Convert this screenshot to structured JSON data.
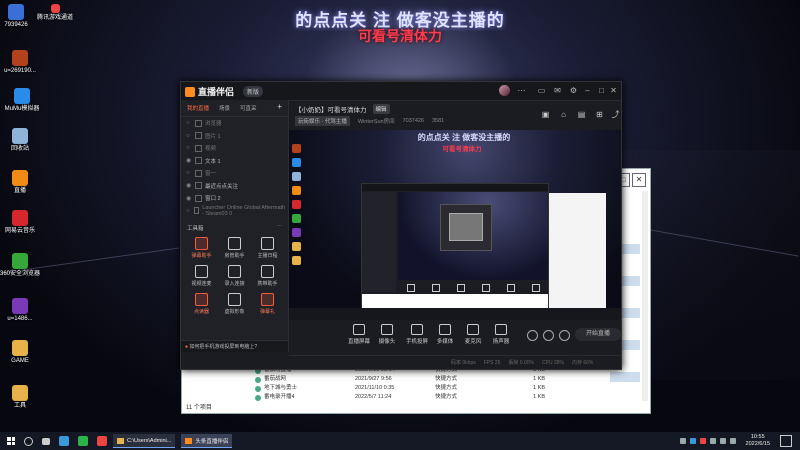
{
  "wallpaper": {
    "banner_title": "的点点关 注 做客没主播的",
    "banner_sub": "可看号清体力"
  },
  "desktop_icons": [
    {
      "label": "7939426",
      "color": "#3a6fd8"
    },
    {
      "label": "u=269190...",
      "color": "#b2421c"
    },
    {
      "label": "MuMu模拟器",
      "color": "#2a8ce8"
    },
    {
      "label": "回收站",
      "color": "#8fb3d9"
    },
    {
      "label": "直播",
      "color": "#f28a16"
    },
    {
      "label": "网易云音乐",
      "color": "#d6262e"
    },
    {
      "label": "360安全浏览器",
      "color": "#36a83a"
    },
    {
      "label": "u=1486...",
      "color": "#7a3ab8"
    },
    {
      "label": "GAME",
      "color": "#e8b24a"
    },
    {
      "label": "工具",
      "color": "#e8b24a"
    }
  ],
  "desktop_top_icon": {
    "label": "腾讯游戏通道",
    "color": "#e44"
  },
  "explorer": {
    "rows": [
      {
        "name": "番茄场直播",
        "date": "2022/2/22 23:14",
        "type": "快捷方式",
        "size": "1 KB"
      },
      {
        "name": "番茄战网",
        "date": "2021/9/27 9:56",
        "type": "快捷方式",
        "size": "1 KB"
      },
      {
        "name": "地下城与勇士",
        "date": "2021/11/10 0:35",
        "type": "快捷方式",
        "size": "1 KB"
      },
      {
        "name": "番电录开播4",
        "date": "2022/5/7 11:24",
        "type": "快捷方式",
        "size": "1 KB"
      }
    ],
    "status": "11 个项目"
  },
  "app": {
    "name": "直播伴侣",
    "version": "新版",
    "side_tabs": [
      "我的直播",
      "场景",
      "可直采"
    ],
    "sources": [
      {
        "label": "浏览器",
        "on": false
      },
      {
        "label": "图片 1",
        "on": false
      },
      {
        "label": "视频",
        "on": false
      },
      {
        "label": "文本 1",
        "on": true
      },
      {
        "label": "窗一",
        "on": false
      },
      {
        "label": "最近点点关注",
        "on": true
      },
      {
        "label": "窗口 2",
        "on": true
      },
      {
        "label": "Launcher Online Global Aftermath - Steam03 0",
        "on": false
      }
    ],
    "tools_title": "工具箱",
    "tools": [
      {
        "label": "弹幕助手",
        "red": true
      },
      {
        "label": "房管助手",
        "red": false
      },
      {
        "label": "主播日程",
        "red": false
      },
      {
        "label": "视频连麦",
        "red": false
      },
      {
        "label": "录入连接",
        "red": false
      },
      {
        "label": "携带助手",
        "red": false
      },
      {
        "label": "点读器",
        "red": true
      },
      {
        "label": "虚拟形象",
        "red": false
      },
      {
        "label": "弹幕礼",
        "red": true
      }
    ],
    "tip": "如何把手机游戏投屏到电脑上?",
    "room_title": "【小奶奶】可看号清体力",
    "room_badge": "编辑",
    "room_category": "玩街娱乐 · 代驾主播",
    "room_meta": [
      "WinterSun房间",
      "7037426",
      "3581"
    ],
    "preview_title": "的点点关 注 做客没主播的",
    "preview_sub": "可看号清体力",
    "live_buttons": [
      "直播屏幕",
      "摄像头",
      "手机投屏",
      "多媒体",
      "麦克风",
      "扬声器"
    ],
    "go_live": "开始直播",
    "status_items": [
      "码率 0kbps",
      "FPS 25",
      "丢帧 0.00%",
      "CPU 28%",
      "内存 66%"
    ]
  },
  "taskbar": {
    "tasks": [
      {
        "label": "C:\\Users\\Admini..."
      },
      {
        "label": "头条直播伴侣"
      }
    ],
    "time": "10:55",
    "date": "2022/6/15"
  }
}
